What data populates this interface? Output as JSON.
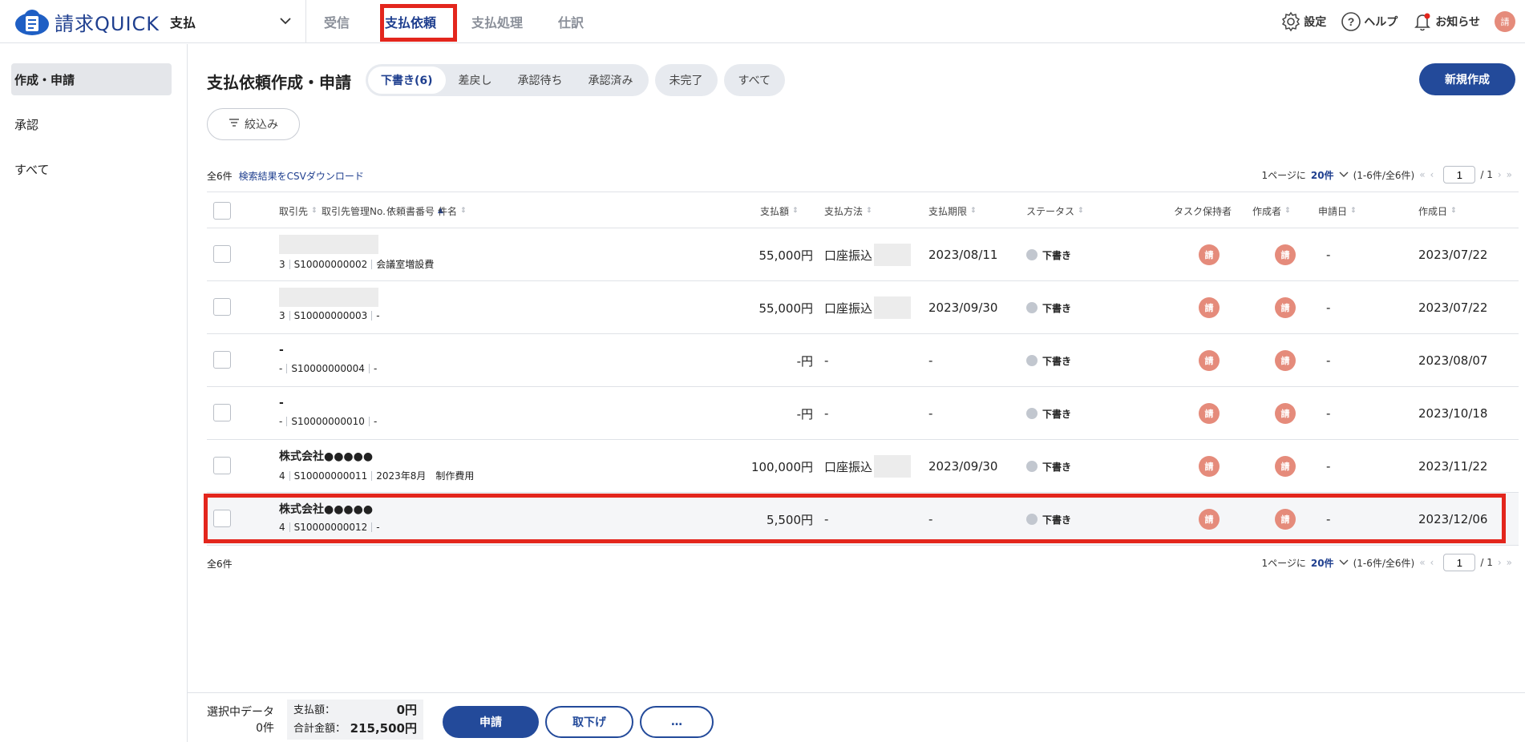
{
  "header": {
    "brand": "請求QUICK",
    "module": "支払",
    "tabs": [
      "受信",
      "支払依頼",
      "支払処理",
      "仕訳"
    ],
    "settings_label": "設定",
    "help_label": "ヘルプ",
    "notice_label": "お知らせ",
    "avatar_char": "請"
  },
  "sidebar": {
    "items": [
      "作成・申請",
      "承認",
      "すべて"
    ]
  },
  "main": {
    "title": "支払依頼作成・申請",
    "status_filters": [
      "下書き(6)",
      "差戻し",
      "承認待ち",
      "承認済み"
    ],
    "extra_filters": [
      "未完了",
      "すべて"
    ],
    "new_button": "新規作成",
    "narrow_button": "絞込み",
    "total_label": "全6件",
    "csv_link": "検索結果をCSVダウンロード",
    "pager": {
      "per_page_prefix": "1ページに",
      "per_page": "20件",
      "range": "(1-6件/全6件)",
      "page": "1",
      "total_pages": "/ 1"
    }
  },
  "table": {
    "columns": {
      "partner": "取引先",
      "partner_no": "取引先管理No.",
      "request_no": "依頼書番号",
      "subject": "件名",
      "amount": "支払額",
      "method": "支払方法",
      "due": "支払期限",
      "status": "ステータス",
      "task_holder": "タスク保持者",
      "creator": "作成者",
      "applied": "申請日",
      "created": "作成日"
    },
    "rows": [
      {
        "partner": "",
        "partner_no": "3",
        "request_no": "S10000000002",
        "subject": "会議室増設費",
        "amount": "55,000円",
        "method": "口座振込",
        "due": "2023/08/11",
        "status": "下書き",
        "task": "請",
        "creator": "請",
        "applied": "-",
        "created": "2023/07/22"
      },
      {
        "partner": "",
        "partner_no": "3",
        "request_no": "S10000000003",
        "subject": "-",
        "amount": "55,000円",
        "method": "口座振込",
        "due": "2023/09/30",
        "status": "下書き",
        "task": "請",
        "creator": "請",
        "applied": "-",
        "created": "2023/07/22"
      },
      {
        "partner": "-",
        "partner_no": "-",
        "request_no": "S10000000004",
        "subject": "-",
        "amount": "-円",
        "method": "-",
        "due": "-",
        "status": "下書き",
        "task": "請",
        "creator": "請",
        "applied": "-",
        "created": "2023/08/07"
      },
      {
        "partner": "-",
        "partner_no": "-",
        "request_no": "S10000000010",
        "subject": "-",
        "amount": "-円",
        "method": "-",
        "due": "-",
        "status": "下書き",
        "task": "請",
        "creator": "請",
        "applied": "-",
        "created": "2023/10/18"
      },
      {
        "partner": "株式会社●●●●●",
        "partner_no": "4",
        "request_no": "S10000000011",
        "subject": "2023年8月　制作費用",
        "amount": "100,000円",
        "method": "口座振込",
        "due": "2023/09/30",
        "status": "下書き",
        "task": "請",
        "creator": "請",
        "applied": "-",
        "created": "2023/11/22"
      },
      {
        "partner": "株式会社●●●●●",
        "partner_no": "4",
        "request_no": "S10000000012",
        "subject": "-",
        "amount": "5,500円",
        "method": "-",
        "due": "-",
        "status": "下書き",
        "task": "請",
        "creator": "請",
        "applied": "-",
        "created": "2023/12/06"
      }
    ]
  },
  "bottom": {
    "selected_label": "選択中データ",
    "selected_count": "0件",
    "payment_label": "支払額：",
    "payment_value": "0円",
    "total_label": "合計金額：",
    "total_value": "215,500円",
    "apply_button": "申請",
    "withdraw_button": "取下げ",
    "more_button": "…"
  },
  "colors": {
    "brand": "#1f3f8f",
    "primary_button": "#234a9a",
    "highlight": "#e3261d",
    "avatar": "#e58b7b"
  }
}
